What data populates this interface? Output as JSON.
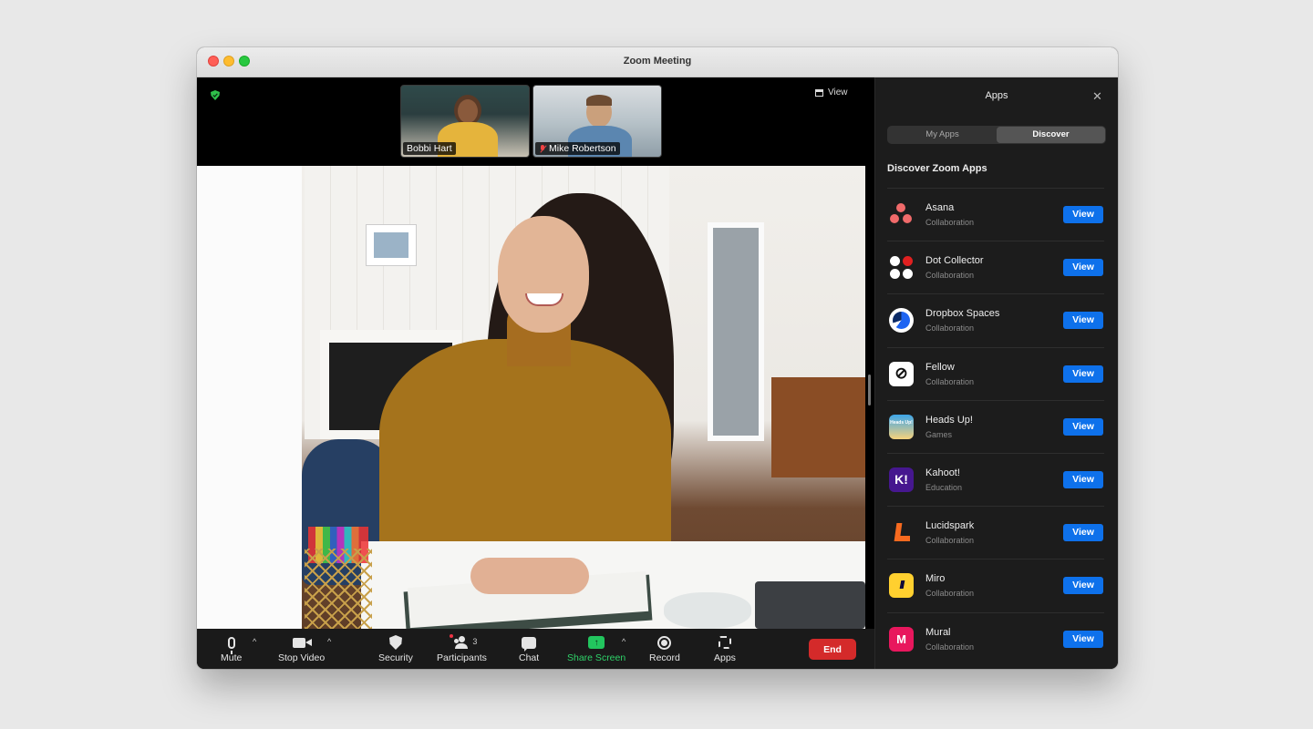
{
  "window": {
    "title": "Zoom Meeting"
  },
  "stage": {
    "view_label": "View",
    "thumbnails": [
      {
        "name": "Bobbi Hart",
        "muted": false
      },
      {
        "name": "Mike Robertson",
        "muted": true
      }
    ]
  },
  "toolbar": {
    "mute_label": "Mute",
    "stop_video_label": "Stop Video",
    "security_label": "Security",
    "participants_label": "Participants",
    "participants_count": "3",
    "chat_label": "Chat",
    "share_screen_label": "Share Screen",
    "record_label": "Record",
    "apps_label": "Apps",
    "end_label": "End"
  },
  "panel": {
    "title": "Apps",
    "tabs": [
      {
        "label": "My Apps",
        "active": false
      },
      {
        "label": "Discover",
        "active": true
      }
    ],
    "section_title": "Discover Zoom Apps",
    "view_label": "View",
    "apps": [
      {
        "name": "Asana",
        "category": "Collaboration",
        "icon": "asana-icon"
      },
      {
        "name": "Dot Collector",
        "category": "Collaboration",
        "icon": "dot-collector-icon"
      },
      {
        "name": "Dropbox Spaces",
        "category": "Collaboration",
        "icon": "dropbox-icon"
      },
      {
        "name": "Fellow",
        "category": "Collaboration",
        "icon": "fellow-icon"
      },
      {
        "name": "Heads Up!",
        "category": "Games",
        "icon": "headsup-icon"
      },
      {
        "name": "Kahoot!",
        "category": "Education",
        "icon": "kahoot-icon"
      },
      {
        "name": "Lucidspark",
        "category": "Collaboration",
        "icon": "lucid-icon"
      },
      {
        "name": "Miro",
        "category": "Collaboration",
        "icon": "miro-icon"
      },
      {
        "name": "Mural",
        "category": "Collaboration",
        "icon": "mural-icon"
      }
    ]
  },
  "colors": {
    "accent_blue": "#0e71eb",
    "end_red": "#d42a2a",
    "share_green": "#22c55e",
    "encryption_green": "#2fbf4a"
  }
}
